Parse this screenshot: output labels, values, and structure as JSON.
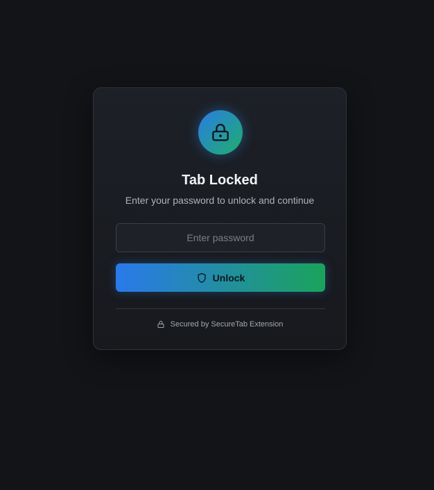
{
  "lock_screen": {
    "icon": "lock-icon",
    "title": "Tab Locked",
    "subtitle": "Enter your password to unlock and continue",
    "password": {
      "placeholder": "Enter password",
      "value": ""
    },
    "unlock_button": {
      "icon": "shield-icon",
      "label": "Unlock"
    },
    "footer": {
      "icon": "lock-icon",
      "text": "Secured by SecureTab Extension"
    }
  },
  "colors": {
    "background": "#121417",
    "card": "#1d2027",
    "accent_blue": "#2a79eb",
    "accent_green": "#1aa35a"
  }
}
